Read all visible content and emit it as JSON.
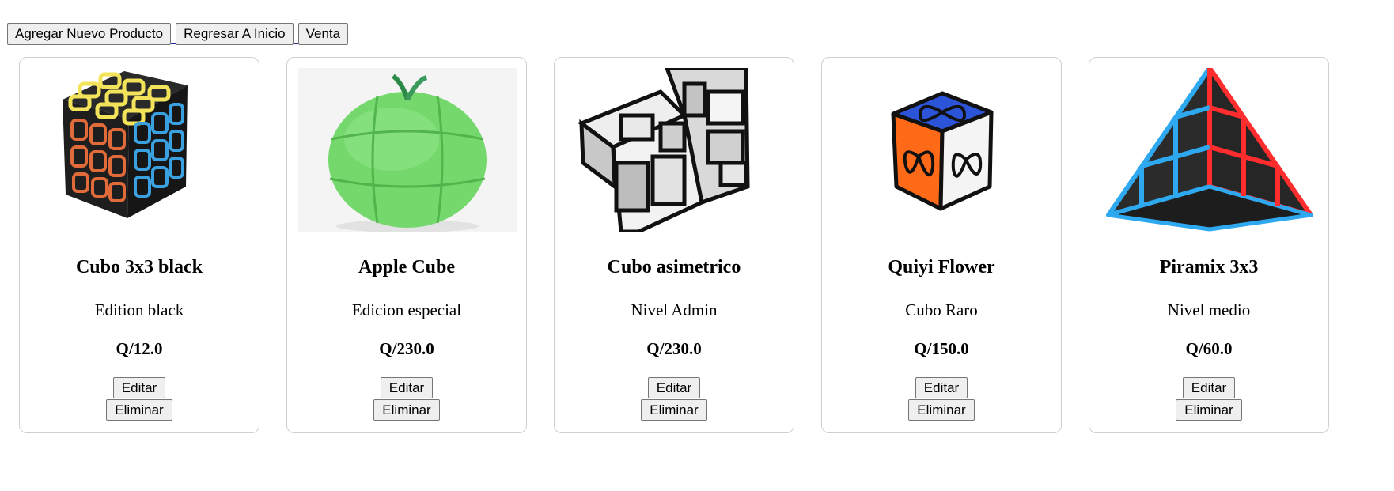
{
  "toolbar": {
    "add_label": "Agregar Nuevo Producto",
    "home_label": "Regresar A Inicio",
    "sale_label": "Venta"
  },
  "products": [
    {
      "name": "Cubo 3x3 black",
      "description": "Edition black",
      "price": "Q/12.0",
      "edit_label": "Editar",
      "delete_label": "Eliminar"
    },
    {
      "name": "Apple Cube",
      "description": "Edicion especial",
      "price": "Q/230.0",
      "edit_label": "Editar",
      "delete_label": "Eliminar"
    },
    {
      "name": "Cubo asimetrico",
      "description": "Nivel Admin",
      "price": "Q/230.0",
      "edit_label": "Editar",
      "delete_label": "Eliminar"
    },
    {
      "name": "Quiyi Flower",
      "description": "Cubo Raro",
      "price": "Q/150.0",
      "edit_label": "Editar",
      "delete_label": "Eliminar"
    },
    {
      "name": "Piramix 3x3",
      "description": "Nivel medio",
      "price": "Q/60.0",
      "edit_label": "Editar",
      "delete_label": "Eliminar"
    }
  ],
  "colors": {
    "button_bg": "#efefef",
    "button_border": "#767676",
    "card_border": "#cfcfcf"
  }
}
